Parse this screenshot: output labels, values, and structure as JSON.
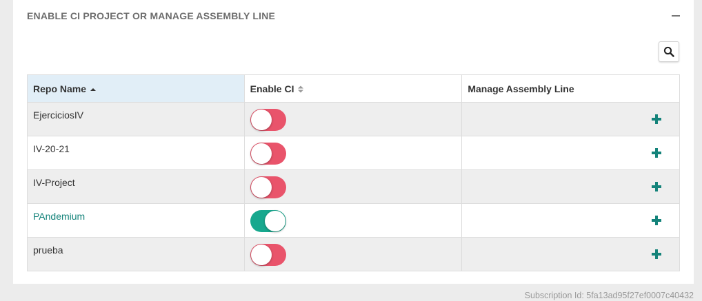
{
  "panel": {
    "title": "ENABLE CI PROJECT OR MANAGE ASSEMBLY LINE"
  },
  "table": {
    "headers": {
      "repo_name": "Repo Name",
      "enable_ci": "Enable CI",
      "manage_assembly_line": "Manage Assembly Line"
    },
    "rows": [
      {
        "name": "EjerciciosIV",
        "ci_enabled": false
      },
      {
        "name": "IV-20-21",
        "ci_enabled": false
      },
      {
        "name": "IV-Project",
        "ci_enabled": false
      },
      {
        "name": "PAndemium",
        "ci_enabled": true
      },
      {
        "name": "prueba",
        "ci_enabled": false
      }
    ]
  },
  "footer": {
    "subscription": "Subscription Id: 5fa13ad95f27ef0007c40432"
  },
  "colors": {
    "toggle_off": "#e9546b",
    "toggle_on": "#17a88e",
    "accent": "#14837a",
    "sorted_header": "#e1eef7"
  }
}
